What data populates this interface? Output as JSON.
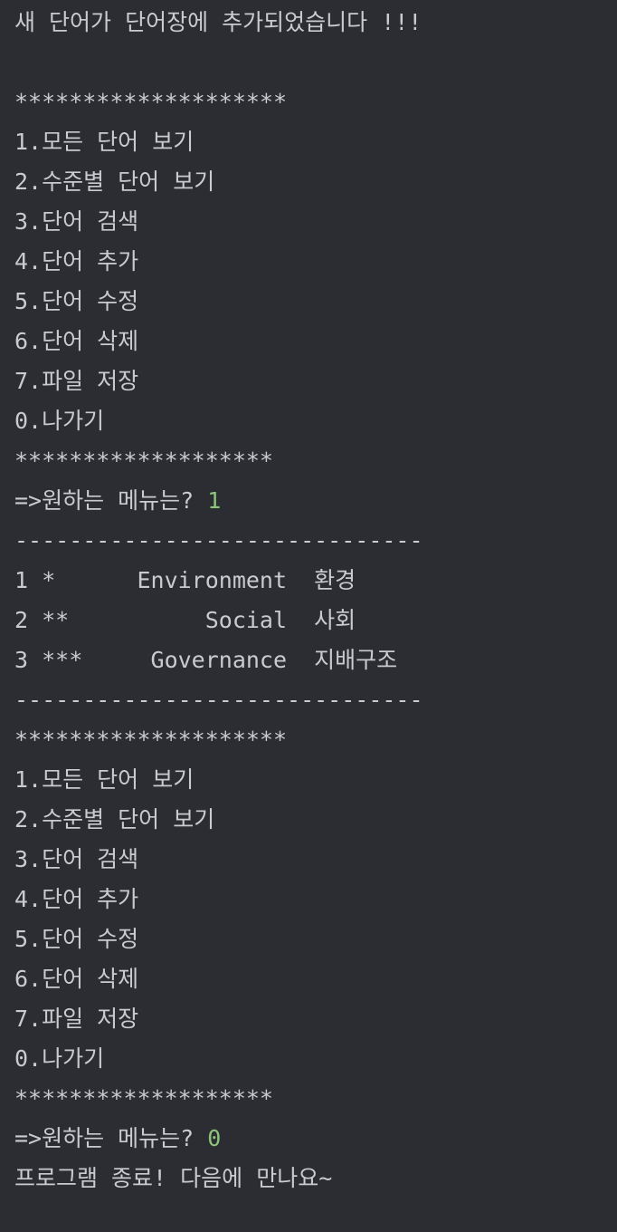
{
  "colors": {
    "background": "#2b2d33",
    "text": "#c9cbcf",
    "user_input": "#8cc47a"
  },
  "lines": [
    {
      "text": "새 단어가 단어장에 추가되었습니다 !!!"
    },
    {
      "text": ""
    },
    {
      "text": "********************"
    },
    {
      "text": "1.모든 단어 보기"
    },
    {
      "text": "2.수준별 단어 보기"
    },
    {
      "text": "3.단어 검색"
    },
    {
      "text": "4.단어 추가"
    },
    {
      "text": "5.단어 수정"
    },
    {
      "text": "6.단어 삭제"
    },
    {
      "text": "7.파일 저장"
    },
    {
      "text": "0.나가기"
    },
    {
      "text": "*******************"
    },
    {
      "text": "=>원하는 메뉴는? ",
      "input": "1"
    },
    {
      "text": "------------------------------"
    },
    {
      "text": "1 *      Environment  환경"
    },
    {
      "text": "2 **          Social  사회"
    },
    {
      "text": "3 ***     Governance  지배구조"
    },
    {
      "text": "------------------------------"
    },
    {
      "text": "********************"
    },
    {
      "text": "1.모든 단어 보기"
    },
    {
      "text": "2.수준별 단어 보기"
    },
    {
      "text": "3.단어 검색"
    },
    {
      "text": "4.단어 추가"
    },
    {
      "text": "5.단어 수정"
    },
    {
      "text": "6.단어 삭제"
    },
    {
      "text": "7.파일 저장"
    },
    {
      "text": "0.나가기"
    },
    {
      "text": "*******************"
    },
    {
      "text": "=>원하는 메뉴는? ",
      "input": "0"
    },
    {
      "text": "프로그램 종료! 다음에 만나요~"
    }
  ]
}
